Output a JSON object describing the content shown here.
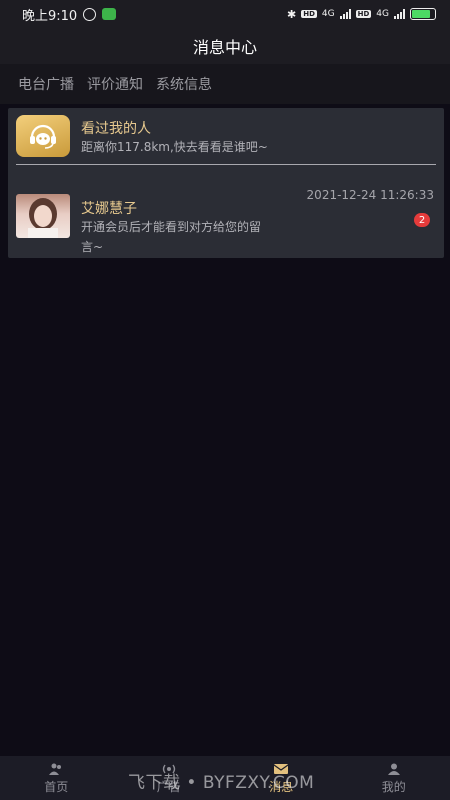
{
  "status_bar": {
    "time": "晚上9:10",
    "hd1": "HD",
    "hd2": "HD",
    "net1": "4G",
    "net2": "4G"
  },
  "header": {
    "title": "消息中心"
  },
  "tabs": [
    {
      "label": "电台广播"
    },
    {
      "label": "评价通知"
    },
    {
      "label": "系统信息"
    }
  ],
  "messages": [
    {
      "title": "看过我的人",
      "subtitle": "距离你117.8km,快去看看是谁吧~"
    },
    {
      "title": "艾娜慧子",
      "time": "2021-12-24 11:26:33",
      "preview_line1": "开通会员后才能看到对方给您的留",
      "preview_line2": "言~",
      "unread_count": "2"
    }
  ],
  "bottom_nav": [
    {
      "label": "首页",
      "icon": "home-icon"
    },
    {
      "label": "广告",
      "icon": "broadcast-icon"
    },
    {
      "label": "消息",
      "icon": "mail-icon"
    },
    {
      "label": "我的",
      "icon": "profile-icon"
    }
  ],
  "watermark": "飞下载 • BYFZXY.COM",
  "colors": {
    "accent": "#e7c98f",
    "badge": "#e53b3b",
    "background": "#0e0c16",
    "panel": "#2b2d35"
  }
}
